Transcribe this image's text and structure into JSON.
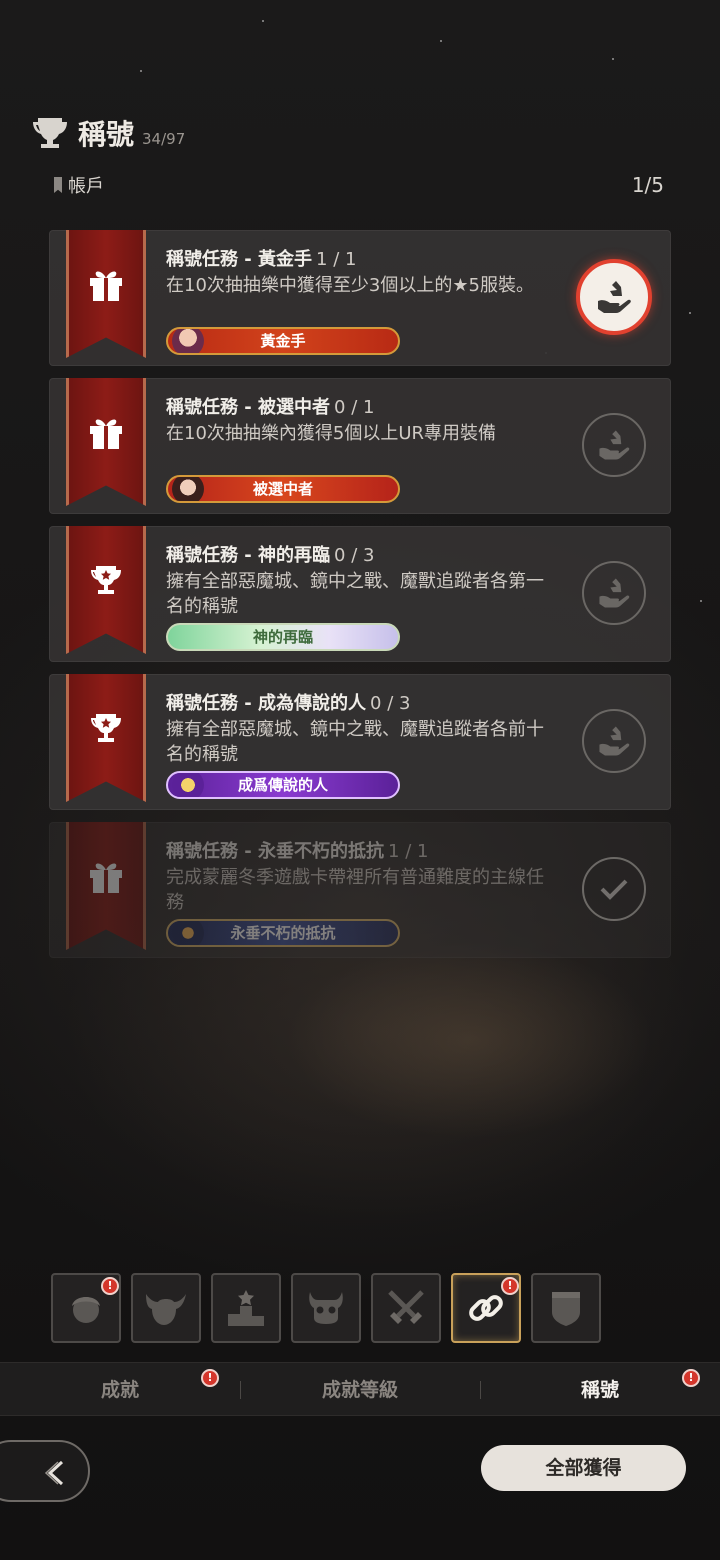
{
  "header": {
    "title": "稱號",
    "count": "34/97",
    "icon": "trophy-icon"
  },
  "subheader": {
    "tag": "帳戶",
    "pager": "1/5"
  },
  "missions": [
    {
      "title": "稱號任務 - 黃金手",
      "progress": "1 / 1",
      "desc": "在10次抽抽樂中獲得至少3個以上的★5服裝。",
      "pill": "黃金手",
      "banner_icon": "gift-icon",
      "state": "claimable"
    },
    {
      "title": "稱號任務 - 被選中者",
      "progress": "0 / 1",
      "desc": "在10次抽抽樂內獲得5個以上UR專用裝備",
      "pill": "被選中者",
      "banner_icon": "gift-icon",
      "state": "locked"
    },
    {
      "title": "稱號任務 - 神的再臨",
      "progress": "0 / 3",
      "desc": "擁有全部惡魔城、鏡中之戰、魔獸追蹤者各第一名的稱號",
      "pill": "神的再臨",
      "banner_icon": "trophy-icon",
      "state": "locked"
    },
    {
      "title": "稱號任務 - 成為傳說的人",
      "progress": "0 / 3",
      "desc": "擁有全部惡魔城、鏡中之戰、魔獸追蹤者各前十名的稱號",
      "pill": "成爲傳說的人",
      "banner_icon": "trophy-icon",
      "state": "locked"
    },
    {
      "title": "稱號任務 - 永垂不朽的抵抗",
      "progress": "1 / 1",
      "desc": "完成蒙麗冬季遊戲卡帶裡所有普通難度的主線任務",
      "pill": "永垂不朽的抵抗",
      "banner_icon": "gift-icon",
      "state": "completed"
    }
  ],
  "categories": [
    {
      "name": "hero-face-icon",
      "alert": true,
      "selected": false
    },
    {
      "name": "demon-head-icon",
      "alert": false,
      "selected": false
    },
    {
      "name": "podium-icon",
      "alert": false,
      "selected": false
    },
    {
      "name": "horned-skull-icon",
      "alert": false,
      "selected": false
    },
    {
      "name": "crossed-swords-icon",
      "alert": false,
      "selected": false
    },
    {
      "name": "chain-link-icon",
      "alert": true,
      "selected": true
    },
    {
      "name": "shield-banner-icon",
      "alert": false,
      "selected": false
    }
  ],
  "tabs": [
    {
      "label": "成就",
      "alert": true,
      "active": false
    },
    {
      "label": "成就等級",
      "alert": false,
      "active": false
    },
    {
      "label": "稱號",
      "alert": true,
      "active": true
    }
  ],
  "alert_glyph": "!",
  "buttons": {
    "claim_all": "全部獲得",
    "back": "back-arrow-icon"
  },
  "colors": {
    "banner_red": "#8d1c17",
    "alert_red": "#d4362b",
    "claim_ring": "#e1412f",
    "selected_gold": "#c9a15a"
  }
}
